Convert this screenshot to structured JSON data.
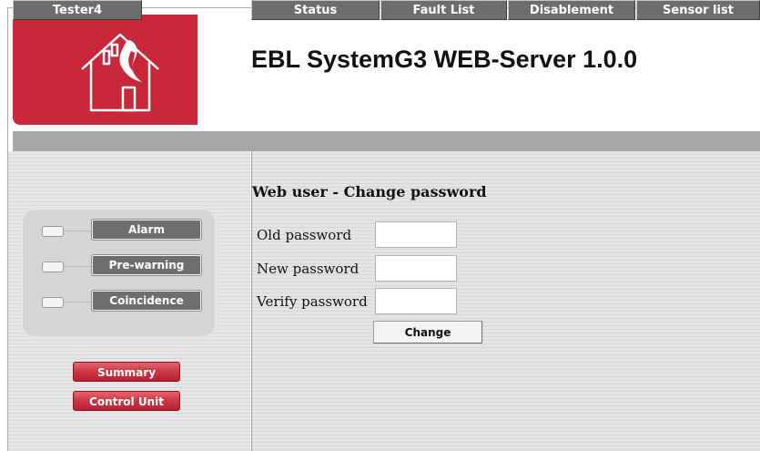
{
  "header": {
    "title": "EBL SystemG3 WEB-Server 1.0.0",
    "logo_icon": "house-flame-icon",
    "brand_color": "#c8283a"
  },
  "nav": {
    "user": "Tester4",
    "items": [
      {
        "label": "Status"
      },
      {
        "label": "Fault List"
      },
      {
        "label": "Disablement"
      },
      {
        "label": "Sensor list"
      }
    ]
  },
  "sidebar": {
    "indicators": [
      {
        "label": "Alarm",
        "led": "off"
      },
      {
        "label": "Pre-warning",
        "led": "off"
      },
      {
        "label": "Coincidence",
        "led": "off"
      }
    ],
    "buttons": [
      {
        "label": "Summary"
      },
      {
        "label": "Control Unit"
      }
    ]
  },
  "main": {
    "title": "Web user - Change password",
    "fields": [
      {
        "label": "Old password",
        "value": ""
      },
      {
        "label": "New password",
        "value": ""
      },
      {
        "label": "Verify password",
        "value": ""
      }
    ],
    "submit_label": "Change"
  }
}
